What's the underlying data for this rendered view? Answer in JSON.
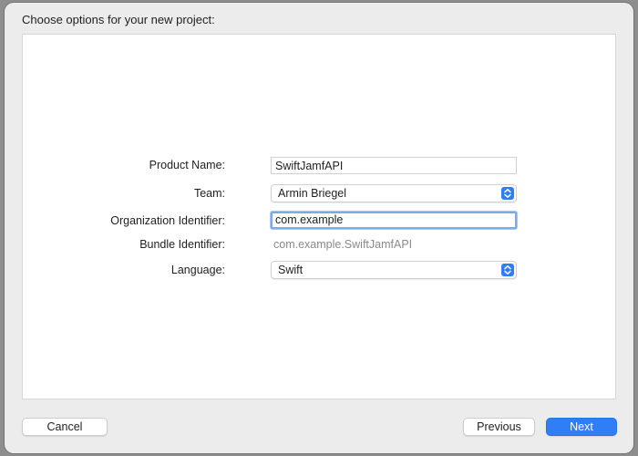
{
  "dialog": {
    "heading": "Choose options for your new project:"
  },
  "form": {
    "product_name": {
      "label": "Product Name:",
      "value": "SwiftJamfAPI"
    },
    "team": {
      "label": "Team:",
      "value": "Armin Briegel"
    },
    "organization_identifier": {
      "label": "Organization Identifier:",
      "value": "com.example"
    },
    "bundle_identifier": {
      "label": "Bundle Identifier:",
      "value": "com.example.SwiftJamfAPI"
    },
    "language": {
      "label": "Language:",
      "value": "Swift"
    }
  },
  "buttons": {
    "cancel": "Cancel",
    "previous": "Previous",
    "next": "Next"
  },
  "colors": {
    "accent": "#2f7ef6",
    "focus_ring": "#7da9e8",
    "window_background": "#ececec",
    "panel_background": "#ffffff",
    "secondary_text": "#8a8a8a"
  },
  "icons": {
    "popup": "up-down-chevron-icon"
  }
}
